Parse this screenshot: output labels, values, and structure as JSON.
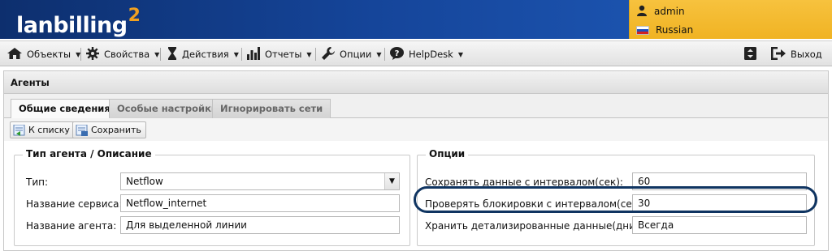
{
  "header": {
    "logo_text": "lanbilling",
    "logo_sup": "2",
    "user": "admin",
    "language": "Russian",
    "colors": {
      "header_bg": "#15459a",
      "userbox_bg": "#f3b82d",
      "logo_accent": "#f0a020"
    }
  },
  "menu": {
    "items": [
      {
        "label": "Объекты",
        "icon": "house-icon"
      },
      {
        "label": "Свойства",
        "icon": "gear-icon"
      },
      {
        "label": "Действия",
        "icon": "hourglass-icon"
      },
      {
        "label": "Отчеты",
        "icon": "bar-chart-icon"
      },
      {
        "label": "Опции",
        "icon": "wrench-icon"
      },
      {
        "label": "HelpDesk",
        "icon": "help-bubble-icon"
      }
    ],
    "logout_label": "Выход"
  },
  "panel": {
    "title": "Агенты",
    "tabs": [
      "Общие сведения",
      "Особые настройки",
      "Игнорировать сети"
    ],
    "active_tab": "Общие сведения",
    "toolbar": {
      "back_label": "К списку",
      "save_label": "Сохранить"
    }
  },
  "agent_type": {
    "legend": "Тип агента / Описание",
    "type_label": "Тип:",
    "type_value": "Netflow",
    "service_label": "Название сервиса:",
    "service_value": "Netflow_internet",
    "agent_label": "Название агента:",
    "agent_value": "Для выделенной линии"
  },
  "options": {
    "legend": "Опции",
    "save_interval_label": "Сохранять данные с интервалом(сек):",
    "save_interval_value": "60",
    "block_check_label": "Проверять блокировки с интервалом(сек):",
    "block_check_value": "30",
    "detail_keep_label": "Хранить детализированные данные(дни):",
    "detail_keep_value": "Всегда"
  }
}
